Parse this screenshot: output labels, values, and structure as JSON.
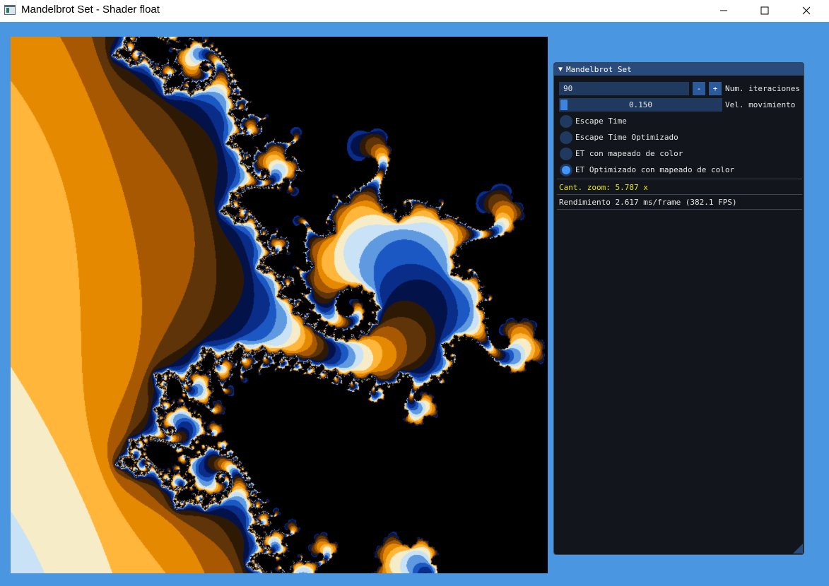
{
  "window": {
    "title": "Mandelbrot Set - Shader float",
    "controls": {
      "minimize_icon": "minimize-icon",
      "maximize_icon": "maximize-icon",
      "close_icon": "close-icon"
    }
  },
  "fractal": {
    "palette": [
      "#000000",
      "#04124a",
      "#0a2d8a",
      "#1c58c4",
      "#5f9ae0",
      "#c9e2f6",
      "#f6ecc8",
      "#ffb63a",
      "#e58a00",
      "#a85800",
      "#5e3408",
      "#2e1a04"
    ]
  },
  "panel": {
    "title": "Mandelbrot Set",
    "collapse_icon": "triangle-down-icon",
    "iterations": {
      "value": "90",
      "minus": "-",
      "plus": "+",
      "label": "Num. iteraciones"
    },
    "speed": {
      "value": "0.150",
      "fraction": 0.15,
      "label": "Vel. movimiento"
    },
    "modes": [
      {
        "label": "Escape Time",
        "selected": false
      },
      {
        "label": "Escape Time Optimizado",
        "selected": false
      },
      {
        "label": "ET con mapeado de color",
        "selected": false
      },
      {
        "label": "ET Optimizado con mapeado de color",
        "selected": true
      }
    ],
    "zoom_text": "Cant. zoom: 5.787 x",
    "performance_text": "Rendimiento 2.617 ms/frame (382.1 FPS)",
    "accent_color": "#4296fa",
    "zoom_text_color": "#e6e600"
  }
}
